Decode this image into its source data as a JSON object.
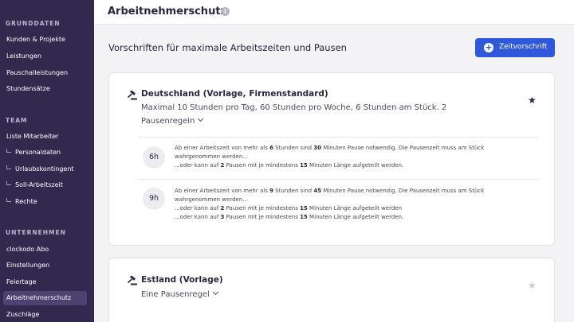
{
  "sidebar": {
    "sections": {
      "grunddaten": "GRUNDDATEN",
      "team": "TEAM",
      "unternehmen": "UNTERNEHMEN"
    },
    "items": {
      "kunden": "Kunden & Projekte",
      "leistungen": "Leistungen",
      "pauschal": "Pauschalleistungen",
      "stundensaetze": "Stundensätze",
      "mitarbeiter": "Liste Mitarbeiter",
      "personaldaten": "Personaldaten",
      "urlaub": "Urlaubskontingent",
      "soll": "Soll-Arbeitszeit",
      "rechte": "Rechte",
      "abo": "clockodo Abo",
      "einstellungen": "Einstellungen",
      "feiertage": "Feiertage",
      "arbeitnehmerschutz": "Arbeitnehmerschutz",
      "zuschlaege": "Zuschläge"
    }
  },
  "header": {
    "title": "Arbeitnehmerschutz",
    "info_icon": "i"
  },
  "main": {
    "subtitle": "Vorschriften für maximale Arbeitszeiten und Pausen",
    "add_button": "Zeitvorschrift",
    "add_icon": "+"
  },
  "cards": [
    {
      "title": "Deutschland (Vorlage, Firmenstandard)",
      "description": "Maximal 10 Stunden pro Tag, 60 Stunden pro Woche, 6 Stunden am Stück. 2",
      "rules_toggle": "Pausenregeln",
      "star": "★",
      "rules": [
        {
          "badge": "6h",
          "line1_a": "Ab einer Arbeitszeit von mehr als ",
          "line1_h": "6",
          "line1_b": " Stunden sind ",
          "line1_m": "30",
          "line1_c": " Minuten Pause notwendig. Die Pausenzeit muss am Stück wahrgenommen werden...",
          "line2_a": "...oder kann auf ",
          "line2_n": "2",
          "line2_b": " Pausen mit je mindestens ",
          "line2_m": "15",
          "line2_c": " Minuten Länge aufgeteilt werden."
        },
        {
          "badge": "9h",
          "line1_a": "Ab einer Arbeitszeit von mehr als ",
          "line1_h": "9",
          "line1_b": " Stunden sind ",
          "line1_m": "45",
          "line1_c": " Minuten Pause notwendig. Die Pausenzeit muss am Stück wahrgenommen werden...",
          "line2_a": "...oder kann auf ",
          "line2_n": "2",
          "line2_b": " Pausen mit je mindestens ",
          "line2_m": "15",
          "line2_c": " Minuten Länge aufgeteilt werden",
          "line3_a": "...oder kann auf ",
          "line3_n": "3",
          "line3_b": " Pausen mit je mindestens ",
          "line3_m": "15",
          "line3_c": " Minuten Länge aufgeteilt werden."
        }
      ]
    },
    {
      "title": "Estland (Vorlage)",
      "rules_toggle": "Eine Pausenregel",
      "star": "★"
    }
  ],
  "colors": {
    "sidebar_bg": "#33294f",
    "sidebar_active": "#4c4370",
    "accent": "#2f58da",
    "star_active": "#2a2640",
    "star_inactive": "#c9c9d2"
  }
}
